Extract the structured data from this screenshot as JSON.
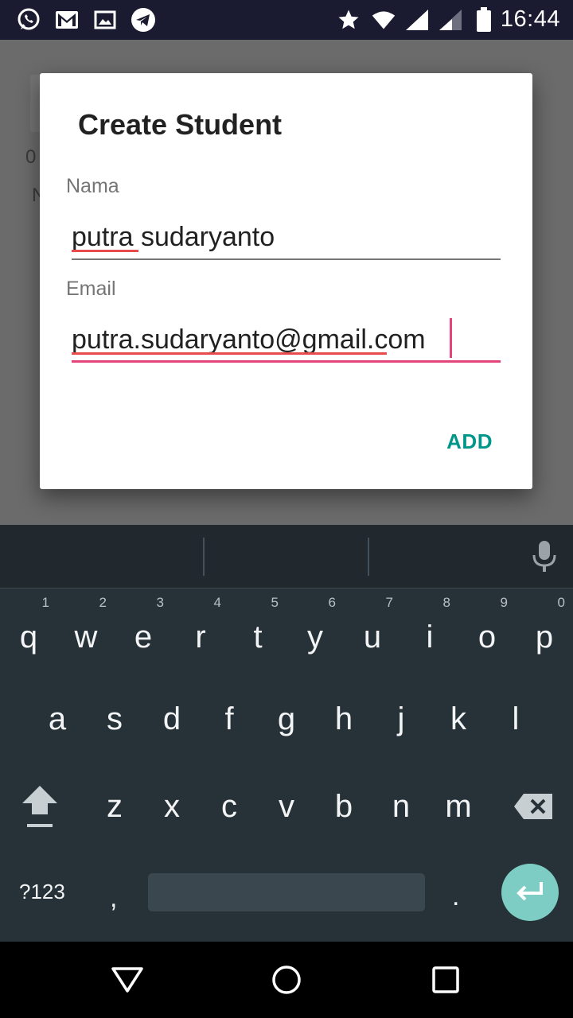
{
  "status_bar": {
    "time": "16:44",
    "icons": [
      "whatsapp-icon",
      "gmail-icon",
      "gallery-icon",
      "telegram-icon",
      "star-icon",
      "wifi-icon",
      "signal-icon",
      "signal-icon",
      "battery-icon"
    ]
  },
  "background": {
    "partial_text_1": "0",
    "partial_text_2": "N"
  },
  "dialog": {
    "title": "Create Student",
    "name_label": "Nama",
    "name_value": "putra sudaryanto",
    "email_label": "Email",
    "email_value": "putra.sudaryanto@gmail.com",
    "add_label": "ADD",
    "accent_color": "#e3457a",
    "button_color": "#00968a"
  },
  "keyboard": {
    "row1": [
      {
        "ch": "q",
        "num": "1"
      },
      {
        "ch": "w",
        "num": "2"
      },
      {
        "ch": "e",
        "num": "3"
      },
      {
        "ch": "r",
        "num": "4"
      },
      {
        "ch": "t",
        "num": "5"
      },
      {
        "ch": "y",
        "num": "6"
      },
      {
        "ch": "u",
        "num": "7"
      },
      {
        "ch": "i",
        "num": "8"
      },
      {
        "ch": "o",
        "num": "9"
      },
      {
        "ch": "p",
        "num": "0"
      }
    ],
    "row2": [
      "a",
      "s",
      "d",
      "f",
      "g",
      "h",
      "j",
      "k",
      "l"
    ],
    "row3": [
      "z",
      "x",
      "c",
      "v",
      "b",
      "n",
      "m"
    ],
    "symbols_label": "?123",
    "comma": ",",
    "period": "."
  },
  "nav": {
    "buttons": [
      "back-icon",
      "home-icon",
      "recents-icon"
    ]
  }
}
